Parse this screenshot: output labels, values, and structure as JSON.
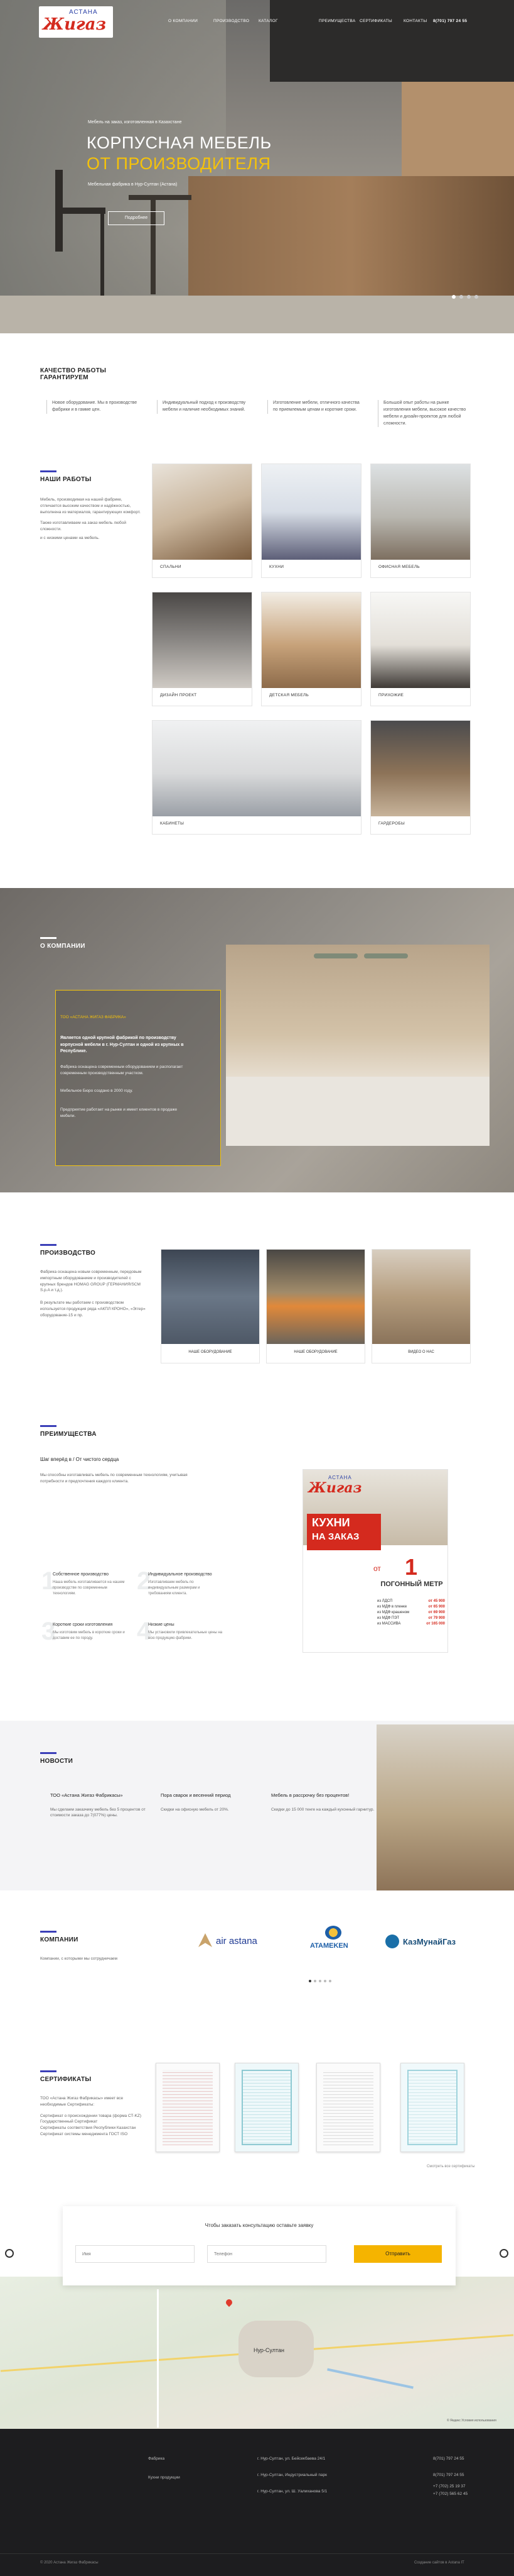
{
  "header": {
    "logo_top": "АСТАНА",
    "logo_main": "Жигаз",
    "nav": [
      "О КОМПАНИИ",
      "ПРОИЗВОДСТВО",
      "КАТАЛОГ",
      "ПРЕИМУЩЕСТВА",
      "СЕРТИФИКАТЫ",
      "КОНТАКТЫ"
    ],
    "phone": "8(701) 797 24 55"
  },
  "hero": {
    "subtitle": "Мебель на заказ, изготовленная в Казахстане",
    "title_line1": "КОРПУСНАЯ МЕБЕЛЬ",
    "title_line2": "ОТ ПРОИЗВОДИТЕЛЯ",
    "caption": "Мебельная фабрика в Нур-Султан (Астана)",
    "button": "Подробнее"
  },
  "quality": {
    "title": "КАЧЕСТВО РАБОТЫ ГАРАНТИРУЕМ",
    "cols": [
      "Новое оборудование. Мы в производстве фабрики и в гамме цен.",
      "Индивидуальный подход к производству мебели и наличие необходимых знаний.",
      "Изготовление мебели, отличного качества по приемлемым ценам и короткие сроки.",
      "Большой опыт работы на рынке изготовления мебели, высокое качество мебели и дизайн-проектов для любой сложности."
    ]
  },
  "works": {
    "title": "НАШИ РАБОТЫ",
    "text1": "Мебель, производимая на нашей фабрике, отличается высоким качеством и надёжностью, выполнена из материалов, гарантирующих комфорт.",
    "text2": "Также изготавливаем на заказ мебель любой сложности.",
    "text3": "и с низкими ценами на мебель.",
    "items": [
      "СПАЛЬНИ",
      "КУХНИ",
      "ОФИСНАЯ МЕБЕЛЬ",
      "ДИЗАЙН ПРОЕКТ",
      "ДЕТСКАЯ МЕБЕЛЬ",
      "ПРИХОЖИЕ",
      "КАБИНЕТЫ",
      "ГАРДЕРОБЫ"
    ]
  },
  "about": {
    "title": "О КОМПАНИИ",
    "box_head": "ТОО «АСТАНА ЖИГАЗ ФАБРИКА»",
    "box_bold": "Является одной крупной фабрикой по производству корпусной мебели в г. Нур-Султан и одной из крупных в Республике.",
    "box_p1": "Фабрика оснащена современным оборудованием и располагает современным производственным участком.",
    "box_p2": "Мебельное Бюро создано в 2000 году.",
    "box_p3": "Предприятие работает на рынке и имеет клиентов в продаже мебели."
  },
  "production": {
    "title": "ПРОИЗВОДСТВО",
    "text1": "Фабрика оснащена новым современным, передовым импортным оборудованием и производителей с крупных брендов HOMAG GROUP (ГЕРМАНИЯ/SCM S.p.A и т.д.).",
    "text2": "В результате мы работаем с производством используется продукция ряда «АКПЛ КРОНО», «Эггер» оборудование-15 и пр.",
    "items": [
      "НАШЕ ОБОРУДОВАНИЕ",
      "НАШЕ ОБОРУДОВАНИЕ",
      "ВИДЕО О НАС"
    ]
  },
  "benefits": {
    "title": "ПРЕИМУЩЕСТВА",
    "subtitle": "Шаг вперёд в / От чистого сердца",
    "intro": "Мы способны изготавливать мебель по современным технологиям, учитывая потребности и предпочтения каждого клиента.",
    "items": [
      {
        "num": "1",
        "title": "Собственное производство",
        "text": "Наша мебель изготавливается на нашем производстве по современным технологиям."
      },
      {
        "num": "2",
        "title": "Индивидуальное производство",
        "text": "Изготавливаем мебель по индивидуальным размерам и требованиям клиента."
      },
      {
        "num": "3",
        "title": "Короткие сроки изготовления",
        "text": "Мы изготовим мебель в короткие сроки и доставим ее по городу."
      },
      {
        "num": "4",
        "title": "Низкие цены",
        "text": "Мы установили привлекательные цены на всю продукцию фабрики."
      }
    ],
    "promo": {
      "brand_top": "АСТАНА",
      "brand": "Жигаз",
      "banner1": "КУХНИ",
      "banner2": "НА ЗАКАЗ",
      "from": "от",
      "big": "1",
      "unit": "ПОГОННЫЙ МЕТР",
      "prices": [
        {
          "label": "из ЛДСП",
          "value": "от 45 900"
        },
        {
          "label": "из МДФ в пленке",
          "value": "от 65 900"
        },
        {
          "label": "из МДФ крашеном",
          "value": "от 69 900"
        },
        {
          "label": "из МДФ ПЭТ",
          "value": "от 79 900"
        },
        {
          "label": "из МАССИВА",
          "value": "от 165 000"
        }
      ]
    }
  },
  "news": {
    "title": "НОВОСТИ",
    "items": [
      {
        "title": "ТОО «Астана Жигаз Фабрикасы»",
        "text": "Мы сделаем заказчику мебель без 5 процентов от стоимости заказа до 7(077%) цены."
      },
      {
        "title": "Пора сварок и весенний период",
        "text": "Скидки на офисную мебель от 20%."
      },
      {
        "title": "Мебель в рассрочку без процентов!",
        "text": "Скидки до 15 000 тенге на каждый кухонный гарнитур."
      }
    ]
  },
  "companies": {
    "title": "КОМПАНИИ",
    "text": "Компании, с которыми мы сотрудничаем",
    "logos": [
      "air astana",
      "ATAMEKEN",
      "КазМунайГаз"
    ]
  },
  "certificates": {
    "title": "СЕРТИФИКАТЫ",
    "intro": "ТОО «Астана Жигаз Фабрикасы» имеет все необходимые Сертификаты:",
    "list": [
      "Сертификат о происхождении товара (форма СТ-KZ)",
      "Государственный Сертификат",
      "Сертификаты соответствия Республики Казахстан",
      "Сертификат системы менеджмента ГОСТ ISO"
    ],
    "more": "Смотреть все сертификаты"
  },
  "form": {
    "title": "Чтобы заказать консультацию оставьте заявку",
    "name_ph": "Имя",
    "phone_ph": "Телефон",
    "submit": "Отправить"
  },
  "map": {
    "city": "Нур-Султан",
    "copyright": "© Яндекс Условия использования"
  },
  "footer": {
    "col1": [
      "Фабрика",
      "Кухни продукции"
    ],
    "col2": [
      "г. Нур-Султан, ул. Бейсекбаева 24/1",
      "г. Нур-Султан, Индустриальный парк",
      "г. Нур-Султан, ул. Ш. Уалиханова 5/1"
    ],
    "phones": [
      "8(701) 797 24 55",
      "8(701) 797 24 55",
      "+7 (702) 25 19 37",
      "+7 (702) 565 62 45"
    ],
    "copyright": "© 2020 Астана Жигаз Фабрикасы",
    "dev": "Создание сайтов в Astana IT"
  }
}
